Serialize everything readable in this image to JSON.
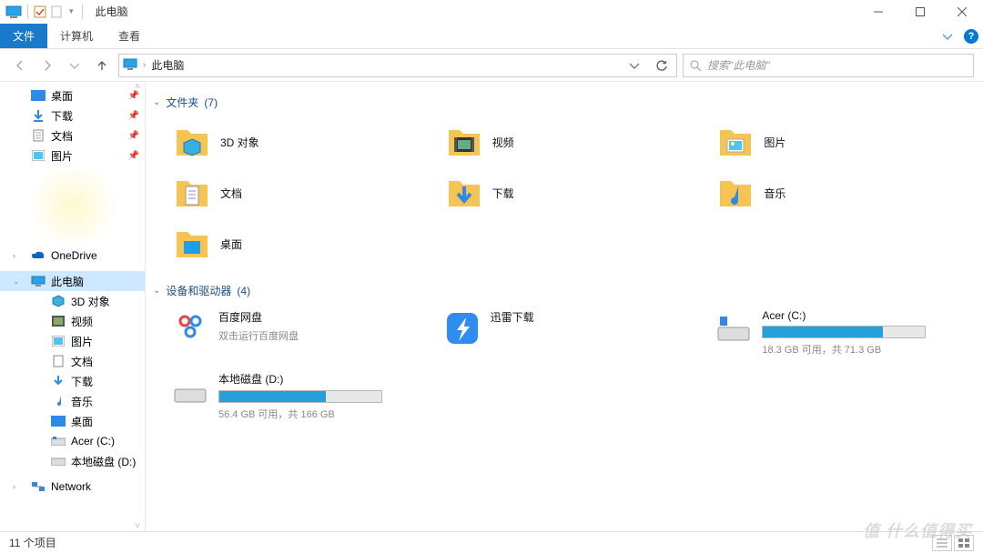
{
  "window": {
    "title": "此电脑"
  },
  "ribbon": {
    "file": "文件",
    "computer": "计算机",
    "view": "查看"
  },
  "address": {
    "location": "此电脑"
  },
  "search": {
    "placeholder": "搜索\"此电脑\""
  },
  "sidebar": {
    "desktop": "桌面",
    "downloads": "下载",
    "documents": "文档",
    "pictures": "图片",
    "onedrive": "OneDrive",
    "this_pc": "此电脑",
    "obj3d": "3D 对象",
    "videos": "视频",
    "pictures2": "图片",
    "documents2": "文档",
    "downloads2": "下载",
    "music": "音乐",
    "desktop2": "桌面",
    "acer_c": "Acer (C:)",
    "local_d": "本地磁盘 (D:)",
    "network": "Network"
  },
  "groups": {
    "folders": {
      "title": "文件夹",
      "count": "(7)"
    },
    "devices": {
      "title": "设备和驱动器",
      "count": "(4)"
    }
  },
  "folders": {
    "obj3d": "3D 对象",
    "videos": "视频",
    "pictures": "图片",
    "documents": "文档",
    "downloads": "下载",
    "music": "音乐",
    "desktop": "桌面"
  },
  "drives": {
    "baidu": {
      "name": "百度网盘",
      "sub": "双击运行百度网盘"
    },
    "thunder": {
      "name": "迅雷下载"
    },
    "acer_c": {
      "name": "Acer (C:)",
      "usage": "18.3 GB 可用，共 71.3 GB",
      "pct": 74
    },
    "local_d": {
      "name": "本地磁盘 (D:)",
      "usage": "56.4 GB 可用，共 166 GB",
      "pct": 66
    }
  },
  "status": {
    "items": "11 个项目"
  },
  "watermark": "值 什么值得买"
}
